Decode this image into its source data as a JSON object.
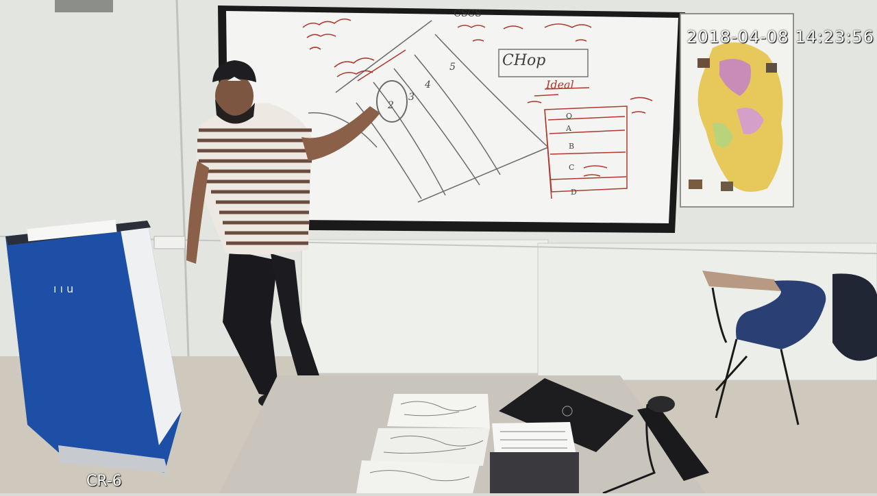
{
  "overlay": {
    "timestamp": "2018-04-08 14:23:56",
    "camera_label": "CR-6"
  },
  "whiteboard": {
    "chop_text": "CHop",
    "ideal_text": "Ideal",
    "cscs_text": "CSCS",
    "number_labels": [
      "2",
      "3",
      "4",
      "5"
    ],
    "horizon_labels": [
      "O",
      "A",
      "B",
      "C",
      "D"
    ]
  },
  "podium": {
    "label": "ı ı  u"
  },
  "colors": {
    "wall": "#e4e6e1",
    "board_frame": "#1a1a1a",
    "board_surface": "#f4f5f3",
    "marker_red": "#b1362c",
    "podium_blue": "#1d4fa6",
    "shirt_stripe": "#6b4b3e"
  }
}
